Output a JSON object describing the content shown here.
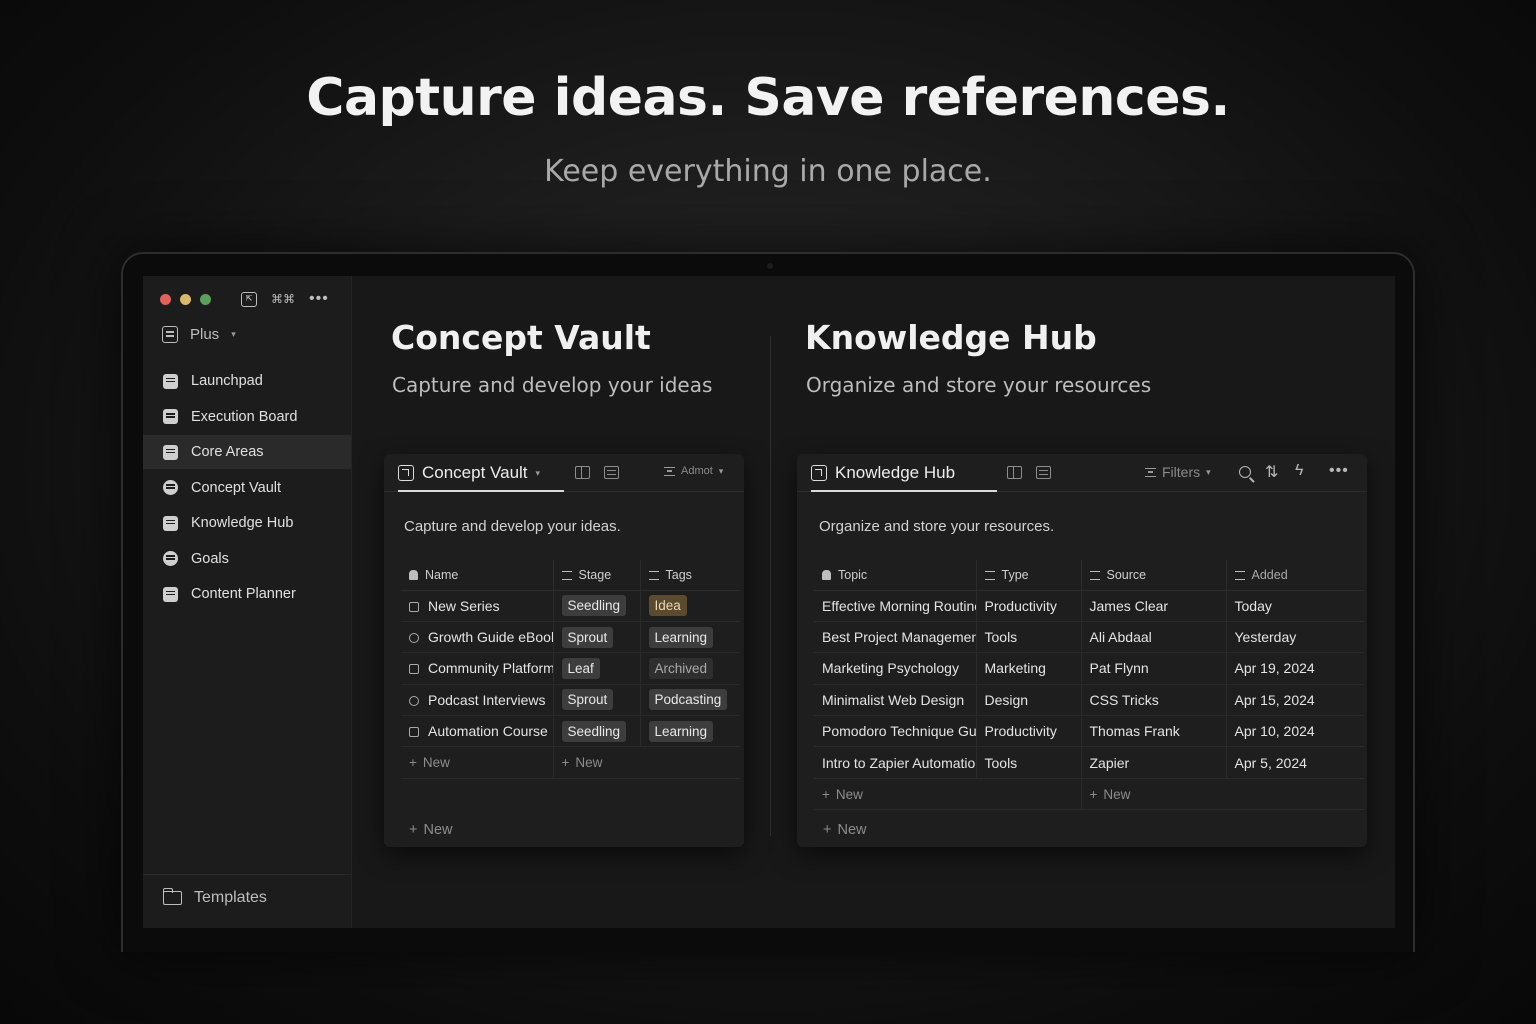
{
  "hero": {
    "title": "Capture ideas. Save references.",
    "subtitle": "Keep everything in one place."
  },
  "colors": {
    "traffic_red": "#e0625b",
    "traffic_yellow": "#d9b96a",
    "traffic_green": "#5e9e5c",
    "idea_tag": "#5b4a2d",
    "tag_default": "#3d3d3d"
  },
  "sidebar": {
    "top_icon_label": "⌘⌘",
    "workspace": "Plus",
    "items": [
      {
        "label": "Launchpad",
        "icon": "drawer-icon"
      },
      {
        "label": "Execution Board",
        "icon": "drawer-icon"
      },
      {
        "label": "Core Areas",
        "icon": "drawer-icon",
        "active": true
      },
      {
        "label": "Concept Vault",
        "icon": "gear-icon"
      },
      {
        "label": "Knowledge Hub",
        "icon": "list-icon"
      },
      {
        "label": "Goals",
        "icon": "target-icon"
      },
      {
        "label": "Content Planner",
        "icon": "calendar-icon"
      }
    ],
    "footer": "Templates"
  },
  "concept": {
    "title": "Concept Vault",
    "subtitle": "Capture and develop your ideas",
    "tab_label": "Concept Vault",
    "view_label": "Admot",
    "description": "Capture and develop your ideas.",
    "columns": [
      "Name",
      "Stage",
      "Tags"
    ],
    "rows": [
      {
        "name": "New Series",
        "stage": "Seedling",
        "tag": "Idea"
      },
      {
        "name": "Growth Guide eBook",
        "stage": "Sprout",
        "tag": "Learning"
      },
      {
        "name": "Community Platform",
        "stage": "Leaf",
        "tag": "Archived"
      },
      {
        "name": "Podcast Interviews",
        "stage": "Sprout",
        "tag": "Podcasting"
      },
      {
        "name": "Automation Course",
        "stage": "Seedling",
        "tag": "Learning"
      }
    ],
    "new_label": "New"
  },
  "knowledge": {
    "title": "Knowledge Hub",
    "subtitle": "Organize and store your resources",
    "tab_label": "Knowledge Hub",
    "filters_label": "Filters",
    "description": "Organize and store your resources.",
    "columns": [
      "Topic",
      "Type",
      "Source",
      "Added"
    ],
    "rows": [
      {
        "topic": "Effective Morning Routines",
        "type": "Productivity",
        "source": "James Clear",
        "added": "Today"
      },
      {
        "topic": "Best Project Management",
        "type": "Tools",
        "source": "Ali Abdaal",
        "added": "Yesterday"
      },
      {
        "topic": "Marketing Psychology",
        "type": "Marketing",
        "source": "Pat Flynn",
        "added": "Apr 19, 2024"
      },
      {
        "topic": "Minimalist Web Design",
        "type": "Design",
        "source": "CSS Tricks",
        "added": "Apr 15, 2024"
      },
      {
        "topic": "Pomodoro Technique Guide",
        "type": "Productivity",
        "source": "Thomas Frank",
        "added": "Apr 10, 2024"
      },
      {
        "topic": "Intro to Zapier Automation",
        "type": "Tools",
        "source": "Zapier",
        "added": "Apr 5, 2024"
      }
    ],
    "new_label": "New"
  }
}
